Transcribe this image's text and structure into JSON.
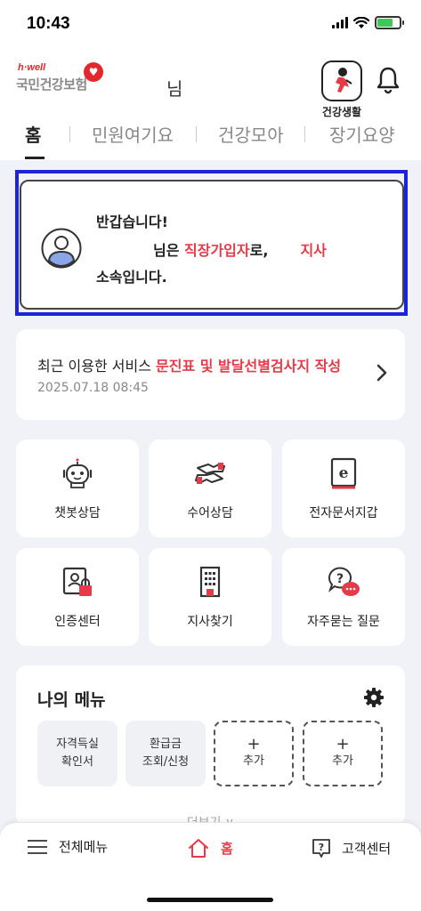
{
  "status_bar": {
    "time": "10:43",
    "battery_level": 0.7
  },
  "header": {
    "logo_brand": "h·well",
    "logo_name": "국민건강보험",
    "user_suffix": "님",
    "health_life_label": "건강생활"
  },
  "tabs": [
    {
      "label": "홈",
      "active": true
    },
    {
      "label": "민원여기요",
      "active": false
    },
    {
      "label": "건강모아",
      "active": false
    },
    {
      "label": "장기요양",
      "active": false
    }
  ],
  "welcome": {
    "greeting": "반갑습니다!",
    "name_suffix": "님은 ",
    "member_type": "직장가입자",
    "after_type": "로,",
    "branch": "지사",
    "belong": "소속입니다."
  },
  "recent_service": {
    "prefix": "최근 이용한 서비스 ",
    "name": "문진표 및 발달선별검사지 작성",
    "datetime": "2025.07.18 08:45"
  },
  "services": [
    {
      "label": "챗봇상담",
      "icon": "chatbot-icon"
    },
    {
      "label": "수어상담",
      "icon": "sign-language-icon"
    },
    {
      "label": "전자문서지갑",
      "icon": "e-document-icon"
    },
    {
      "label": "인증센터",
      "icon": "certificate-lock-icon"
    },
    {
      "label": "지사찾기",
      "icon": "building-icon"
    },
    {
      "label": "자주묻는 질문",
      "icon": "faq-icon"
    }
  ],
  "my_menu": {
    "title": "나의 메뉴",
    "items": [
      {
        "line1": "자격득실",
        "line2": "확인서"
      },
      {
        "line1": "환급금",
        "line2": "조회/신청"
      },
      {
        "plus": "+",
        "line2": "추가"
      },
      {
        "plus": "+",
        "line2": "추가"
      }
    ],
    "more_label": "더보기 ∨"
  },
  "bottom_nav": {
    "menu": "전체메뉴",
    "home": "홈",
    "support": "고객센터"
  },
  "colors": {
    "accent": "#e53a48",
    "focus": "#1a24d8",
    "background": "#f1f2f7"
  }
}
